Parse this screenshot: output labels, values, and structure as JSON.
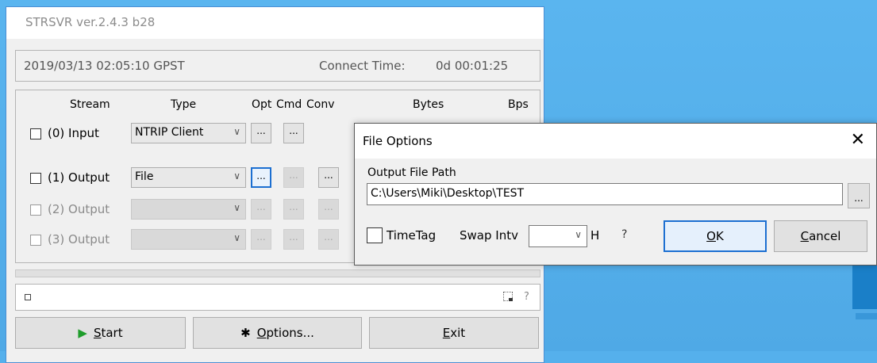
{
  "app": {
    "title": "STRSVR ver.2.4.3 b28",
    "status": {
      "time": "2019/03/13 02:05:10 GPST",
      "connect_label": "Connect Time:",
      "connect_value": "0d 00:01:25"
    },
    "headers": {
      "stream": "Stream",
      "type": "Type",
      "opt": "Opt",
      "cmd": "Cmd",
      "conv": "Conv",
      "bytes": "Bytes",
      "bps": "Bps"
    },
    "rows": [
      {
        "label": "(0) Input",
        "type": "NTRIP Client",
        "opt": "...",
        "cmd": "...",
        "enabled": true
      },
      {
        "label": "(1) Output",
        "type": "File",
        "opt": "...",
        "cmd": "...",
        "conv": "...",
        "enabled": true
      },
      {
        "label": "(2) Output",
        "type": "",
        "opt": "...",
        "cmd": "...",
        "conv": "...",
        "enabled": false
      },
      {
        "label": "(3) Output",
        "type": "",
        "opt": "...",
        "cmd": "...",
        "conv": "...",
        "enabled": false
      }
    ],
    "message_help": "?",
    "buttons": {
      "start_first": "S",
      "start_rest": "tart",
      "options_first": "O",
      "options_rest": "ptions...",
      "exit_first": "E",
      "exit_rest": "xit"
    }
  },
  "dialog": {
    "title": "File Options",
    "close": "✕",
    "path_label": "Output File Path",
    "path_value": "C:\\Users\\Miki\\Desktop\\TEST",
    "path_button": "...",
    "timetag_label": "TimeTag",
    "swap_label": "Swap Intv",
    "swap_value": "",
    "swap_unit": "H",
    "help": "?",
    "ok_first": "O",
    "ok_rest": "K",
    "cancel_first": "C",
    "cancel_rest": "ancel"
  },
  "icons": {
    "start": "play-icon",
    "options": "gear-icon",
    "dropdown": "chevron-down-icon"
  },
  "colors": {
    "desktop": "#55b0ec",
    "focus_border": "#1c6fd1",
    "start_icon": "#1f9d2b"
  }
}
